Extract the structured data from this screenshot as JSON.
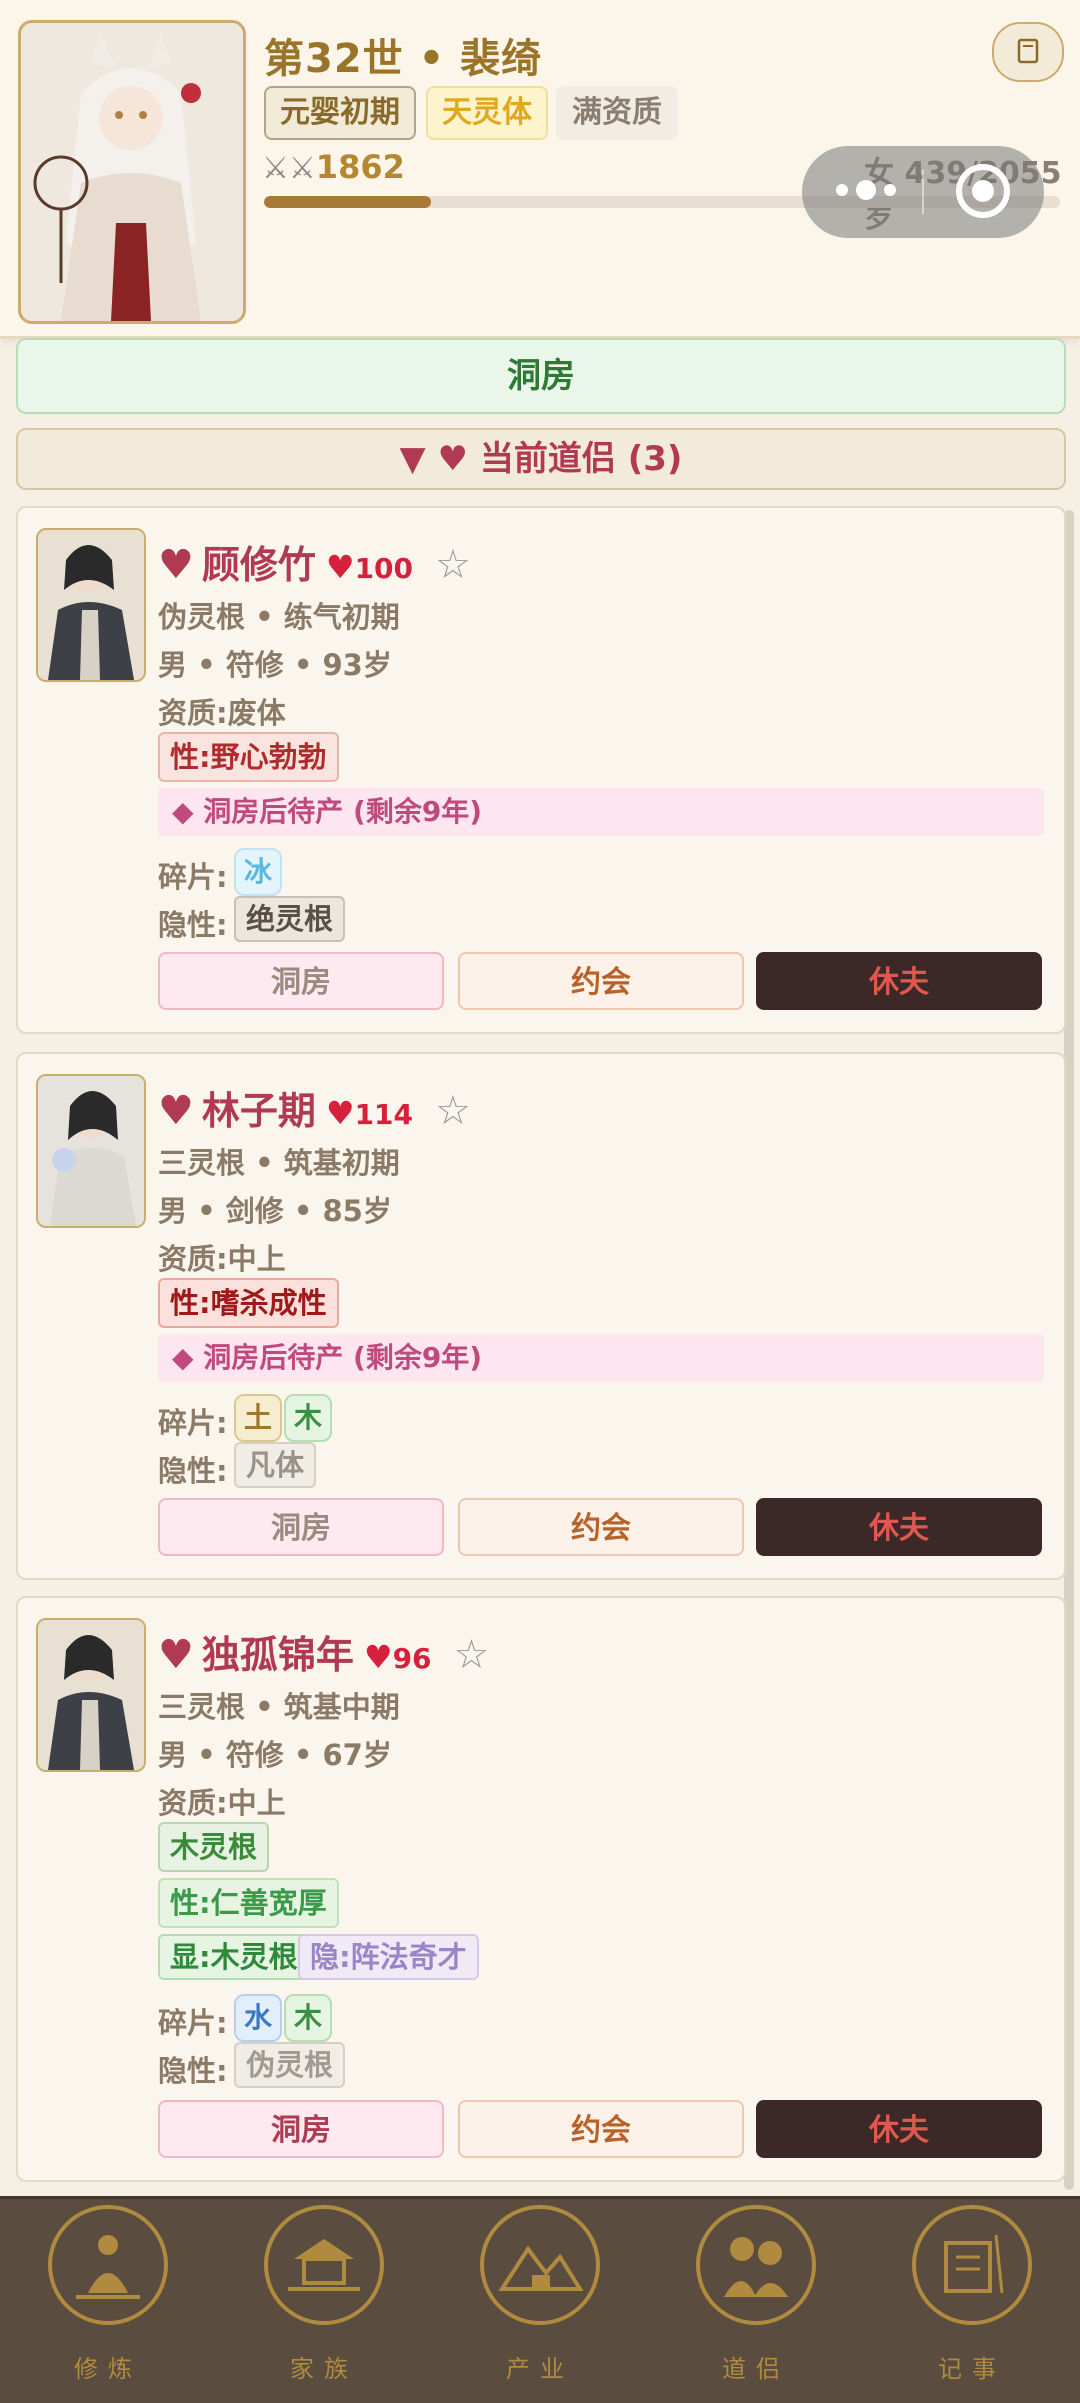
{
  "header": {
    "title": "第32世 • 裴绮",
    "realm": "元婴初期",
    "body_type": "天灵体",
    "aptitude": "满资质",
    "swords": "⚔⚔",
    "power": "1862",
    "gender_age": "女 439/2055岁",
    "age_progress": 0.21,
    "top_right_icon": "book-icon"
  },
  "actions": {
    "chamber_button": "洞房"
  },
  "partners_section": {
    "arrow": "▼",
    "heart": "♥",
    "title": "当前道侣 (3)"
  },
  "partners": [
    {
      "heart": "♥",
      "name": "顾修竹",
      "aff_heart": "♥",
      "affection": "100",
      "star": "☆",
      "root_realm": "伪灵根 • 练气初期",
      "gender_class_age": "男 • 符修 • 93岁",
      "aptitude": "资质:废体",
      "personality": "性:野心勃勃",
      "status": "◆ 洞房后待产 (剩余9年)",
      "fragments_label": "碎片:",
      "fragments": [
        "冰"
      ],
      "hidden_label": "隐性:",
      "hidden": "绝灵根",
      "btn_chamber": "洞房",
      "btn_date": "约会",
      "btn_divorce": "休夫"
    },
    {
      "heart": "♥",
      "name": "林子期",
      "aff_heart": "♥",
      "affection": "114",
      "star": "☆",
      "root_realm": "三灵根 • 筑基初期",
      "gender_class_age": "男 • 剑修 • 85岁",
      "aptitude": "资质:中上",
      "personality": "性:嗜杀成性",
      "status": "◆ 洞房后待产 (剩余9年)",
      "fragments_label": "碎片:",
      "fragments": [
        "土",
        "木"
      ],
      "hidden_label": "隐性:",
      "hidden": "凡体",
      "btn_chamber": "洞房",
      "btn_date": "约会",
      "btn_divorce": "休夫"
    },
    {
      "heart": "♥",
      "name": "独孤锦年",
      "aff_heart": "♥",
      "affection": "96",
      "star": "☆",
      "root_realm": "三灵根 • 筑基中期",
      "gender_class_age": "男 • 符修 • 67岁",
      "aptitude": "资质:中上",
      "spirit_root": "木灵根",
      "personality": "性:仁善宽厚",
      "dominant": "显:木灵根",
      "recessive": "隐:阵法奇才",
      "fragments_label": "碎片:",
      "fragments": [
        "水",
        "木"
      ],
      "hidden_label": "隐性:",
      "hidden": "伪灵根",
      "btn_chamber": "洞房",
      "btn_date": "约会",
      "btn_divorce": "休夫"
    }
  ],
  "nav": [
    {
      "label": "修炼",
      "icon": "meditation-icon"
    },
    {
      "label": "家族",
      "icon": "pavilion-icon"
    },
    {
      "label": "产业",
      "icon": "mountain-icon"
    },
    {
      "label": "道侣",
      "icon": "couple-icon"
    },
    {
      "label": "记事",
      "icon": "scroll-icon"
    }
  ],
  "colors": {
    "accent_gold": "#9a7428",
    "heart_red": "#b03a52",
    "divorce_bg": "#3d2828"
  }
}
